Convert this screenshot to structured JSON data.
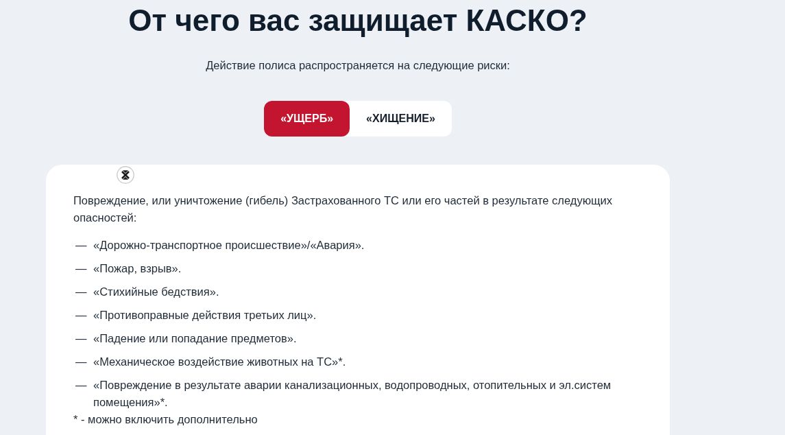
{
  "title": "От чего вас защищает КАСКО?",
  "subtitle": "Действие полиса распространяется на следующие риски:",
  "tabs": [
    {
      "label": "«УЩЕРБ»",
      "selected": true
    },
    {
      "label": "«ХИЩЕНИЕ»",
      "selected": false
    }
  ],
  "panel": {
    "intro": "Повреждение, или уничтожение (гибель) Застрахованного ТС или его частей в результате следующих опасностей:",
    "items": [
      {
        "marker": "—",
        "text": "«Дорожно-транспортное происшествие»/«Авария»."
      },
      {
        "marker": "—",
        "text": "«Пожар, взрыв»."
      },
      {
        "marker": "—",
        "text": "«Стихийные бедствия»."
      },
      {
        "marker": "—",
        "text": "«Противоправные действия третьих лиц»."
      },
      {
        "marker": "—",
        "text": "«Падение или попадание предметов»."
      },
      {
        "marker": "—",
        "text": "«Механическое воздействие животных на ТС»*."
      },
      {
        "marker": "—",
        "text": "«Повреждение в результате аварии канализационных, водопроводных, отопительных и эл.систем помещения»*."
      }
    ],
    "footnote": "* - можно включить дополнительно"
  }
}
